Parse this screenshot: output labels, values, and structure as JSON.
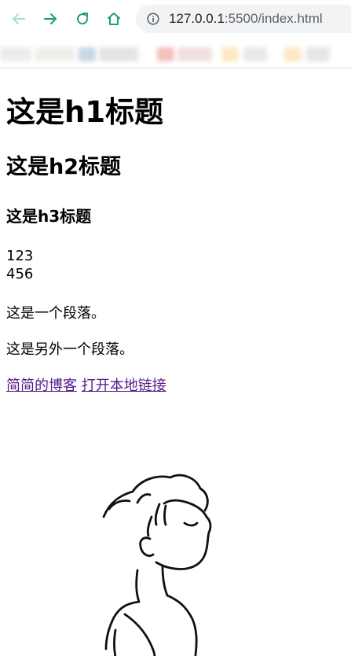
{
  "browser": {
    "url_host": "127.0.0.1",
    "url_rest": ":5500/index.html",
    "icons": {
      "back": "arrow-left-icon",
      "forward": "arrow-right-icon",
      "reload": "reload-icon",
      "home": "home-icon",
      "info": "info-icon"
    },
    "accent_color": "#1a9e7a"
  },
  "page": {
    "h1": "这是h1标题",
    "h2": "这是h2标题",
    "h3": "这是h3标题",
    "line1": "123",
    "line2": "456",
    "paragraph1": "这是一个段落。",
    "paragraph2": "这是另外一个段落。",
    "link1": "简简的博客",
    "link2": "打开本地链接"
  }
}
